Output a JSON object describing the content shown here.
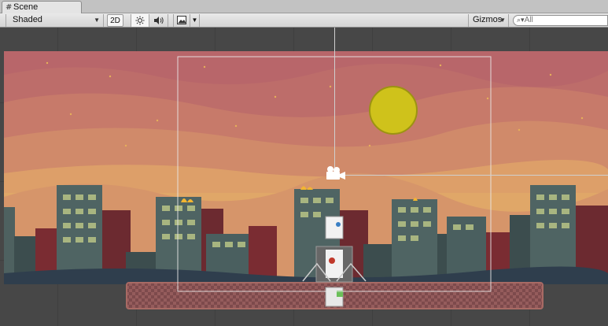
{
  "tab": {
    "title": "Scene",
    "icon": "grid-icon"
  },
  "toolbar": {
    "shading_mode": "Shaded",
    "mode_2d": "2D",
    "lighting_icon": "sun-icon",
    "audio_icon": "speaker-icon",
    "effects_icon": "image-icon",
    "gizmos_label": "Gizmos",
    "search_placeholder": "All"
  },
  "viewport": {
    "background_color": "#474747",
    "sky_colors": [
      "#b8666a",
      "#c77a6a",
      "#d89a6c",
      "#e0a768"
    ],
    "sun_color": "#cfc21b",
    "camera_icon": "camera-icon"
  }
}
